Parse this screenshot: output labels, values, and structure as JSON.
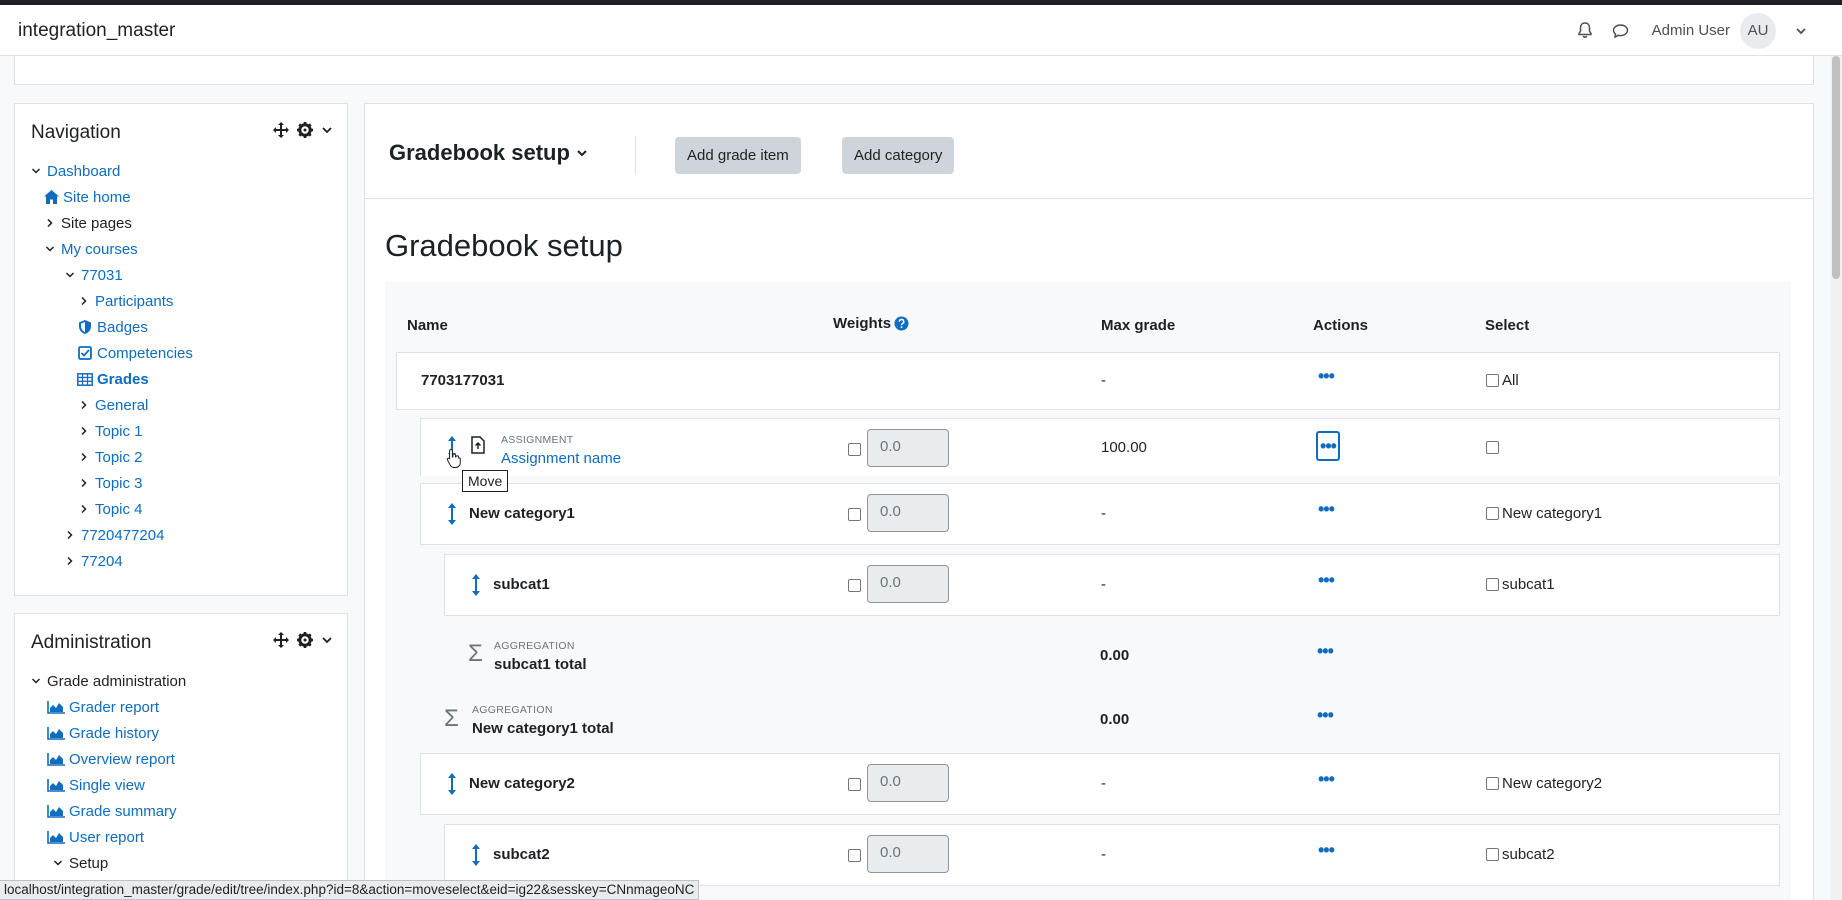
{
  "site": {
    "name": "integration_master"
  },
  "user": {
    "name": "Admin User",
    "initials": "AU"
  },
  "icons": {
    "bell": "bell-icon",
    "chat": "chat-bubble-icon",
    "user_menu": "chevron-down-icon",
    "move_block": "move-arrows-icon",
    "block_settings": "gear-icon",
    "grade_item_move": "move-vertical-icon",
    "assignment": "assignment-file-icon",
    "aggregation": "sigma-icon",
    "actions": "ellipsis-icon",
    "help": "help-icon"
  },
  "colors": {
    "link": "#0f6cbf",
    "button": "#ced4da",
    "topbar": "#1d2125"
  },
  "navigation": {
    "title": "Navigation",
    "items": [
      {
        "label": "Dashboard"
      },
      {
        "label": "Site home"
      },
      {
        "label": "Site pages"
      },
      {
        "label": "My courses"
      },
      {
        "label": "77031"
      },
      {
        "label": "Participants"
      },
      {
        "label": "Badges"
      },
      {
        "label": "Competencies"
      },
      {
        "label": "Grades"
      },
      {
        "label": "General"
      },
      {
        "label": "Topic 1"
      },
      {
        "label": "Topic 2"
      },
      {
        "label": "Topic 3"
      },
      {
        "label": "Topic 4"
      },
      {
        "label": "7720477204"
      },
      {
        "label": "77204"
      }
    ]
  },
  "administration": {
    "title": "Administration",
    "items": [
      {
        "label": "Grade administration"
      },
      {
        "label": "Grader report"
      },
      {
        "label": "Grade history"
      },
      {
        "label": "Overview report"
      },
      {
        "label": "Single view"
      },
      {
        "label": "Grade summary"
      },
      {
        "label": "User report"
      },
      {
        "label": "Setup"
      }
    ]
  },
  "tertiary": {
    "selector": "Gradebook setup",
    "add_grade_item": "Add grade item",
    "add_category": "Add category"
  },
  "page": {
    "heading": "Gradebook setup"
  },
  "table": {
    "headers": {
      "name": "Name",
      "weights": "Weights",
      "max_grade": "Max grade",
      "actions": "Actions",
      "select": "Select"
    },
    "rows": [
      {
        "name": "7703177031",
        "max": "-",
        "select_label": "All"
      },
      {
        "type": "ASSIGNMENT",
        "name": "Assignment name",
        "weight": "0.0",
        "max": "100.00"
      },
      {
        "name": "New category1",
        "weight": "0.0",
        "max": "-",
        "select_label": "New category1"
      },
      {
        "name": "subcat1",
        "weight": "0.0",
        "max": "-",
        "select_label": "subcat1"
      },
      {
        "type": "AGGREGATION",
        "name": "subcat1 total",
        "max": "0.00"
      },
      {
        "type": "AGGREGATION",
        "name": "New category1 total",
        "max": "0.00"
      },
      {
        "name": "New category2",
        "weight": "0.0",
        "max": "-",
        "select_label": "New category2"
      },
      {
        "name": "subcat2",
        "weight": "0.0",
        "max": "-",
        "select_label": "subcat2"
      }
    ]
  },
  "tooltip": {
    "text": "Move"
  },
  "status_url": "localhost/integration_master/grade/edit/tree/index.php?id=8&action=moveselect&eid=ig22&sesskey=CNnmageoNC"
}
